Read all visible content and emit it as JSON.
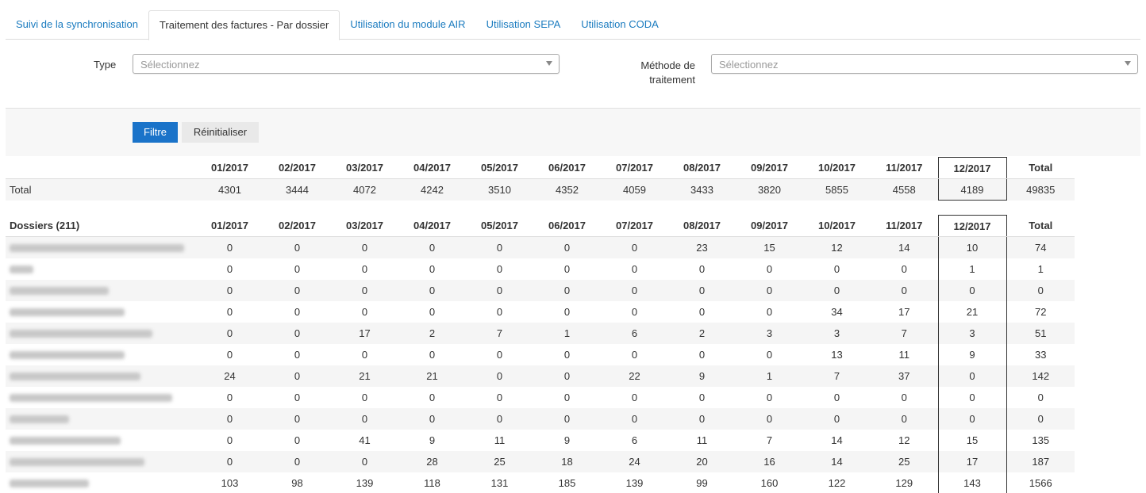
{
  "tabs": [
    {
      "label": "Suivi de la synchronisation",
      "active": false
    },
    {
      "label": "Traitement des factures - Par dossier",
      "active": true
    },
    {
      "label": "Utilisation du module AIR",
      "active": false
    },
    {
      "label": "Utilisation SEPA",
      "active": false
    },
    {
      "label": "Utilisation CODA",
      "active": false
    }
  ],
  "filters": {
    "type_label": "Type",
    "type_placeholder": "Sélectionnez",
    "method_label_line1": "Méthode de",
    "method_label_line2": "traitement",
    "method_placeholder": "Sélectionnez",
    "filter_button": "Filtre",
    "reset_button": "Réinitialiser"
  },
  "colors": {
    "accent": "#1a73c9",
    "link": "#1a7bbf"
  },
  "months": [
    "01/2017",
    "02/2017",
    "03/2017",
    "04/2017",
    "05/2017",
    "06/2017",
    "07/2017",
    "08/2017",
    "09/2017",
    "10/2017",
    "11/2017",
    "12/2017"
  ],
  "total_header": "Total",
  "total_row": {
    "label": "Total",
    "values": [
      "4301",
      "3444",
      "4072",
      "4242",
      "3510",
      "4352",
      "4059",
      "3433",
      "3820",
      "5855",
      "4558",
      "4189"
    ],
    "total": "49835"
  },
  "dossiers": {
    "header": "Dossiers (211)",
    "rows": [
      {
        "values": [
          "0",
          "0",
          "0",
          "0",
          "0",
          "0",
          "0",
          "23",
          "15",
          "12",
          "14",
          "10"
        ],
        "total": "74"
      },
      {
        "values": [
          "0",
          "0",
          "0",
          "0",
          "0",
          "0",
          "0",
          "0",
          "0",
          "0",
          "0",
          "1"
        ],
        "total": "1"
      },
      {
        "values": [
          "0",
          "0",
          "0",
          "0",
          "0",
          "0",
          "0",
          "0",
          "0",
          "0",
          "0",
          "0"
        ],
        "total": "0"
      },
      {
        "values": [
          "0",
          "0",
          "0",
          "0",
          "0",
          "0",
          "0",
          "0",
          "0",
          "34",
          "17",
          "21"
        ],
        "total": "72"
      },
      {
        "values": [
          "0",
          "0",
          "17",
          "2",
          "7",
          "1",
          "6",
          "2",
          "3",
          "3",
          "7",
          "3"
        ],
        "total": "51"
      },
      {
        "values": [
          "0",
          "0",
          "0",
          "0",
          "0",
          "0",
          "0",
          "0",
          "0",
          "13",
          "11",
          "9"
        ],
        "total": "33"
      },
      {
        "values": [
          "24",
          "0",
          "21",
          "21",
          "0",
          "0",
          "22",
          "9",
          "1",
          "7",
          "37",
          "0"
        ],
        "total": "142"
      },
      {
        "values": [
          "0",
          "0",
          "0",
          "0",
          "0",
          "0",
          "0",
          "0",
          "0",
          "0",
          "0",
          "0"
        ],
        "total": "0"
      },
      {
        "values": [
          "0",
          "0",
          "0",
          "0",
          "0",
          "0",
          "0",
          "0",
          "0",
          "0",
          "0",
          "0"
        ],
        "total": "0"
      },
      {
        "values": [
          "0",
          "0",
          "41",
          "9",
          "11",
          "9",
          "6",
          "11",
          "7",
          "14",
          "12",
          "15"
        ],
        "total": "135"
      },
      {
        "values": [
          "0",
          "0",
          "0",
          "28",
          "25",
          "18",
          "24",
          "20",
          "16",
          "14",
          "25",
          "17"
        ],
        "total": "187"
      },
      {
        "values": [
          "103",
          "98",
          "139",
          "118",
          "131",
          "185",
          "139",
          "99",
          "160",
          "122",
          "129",
          "143"
        ],
        "total": "1566"
      }
    ]
  }
}
